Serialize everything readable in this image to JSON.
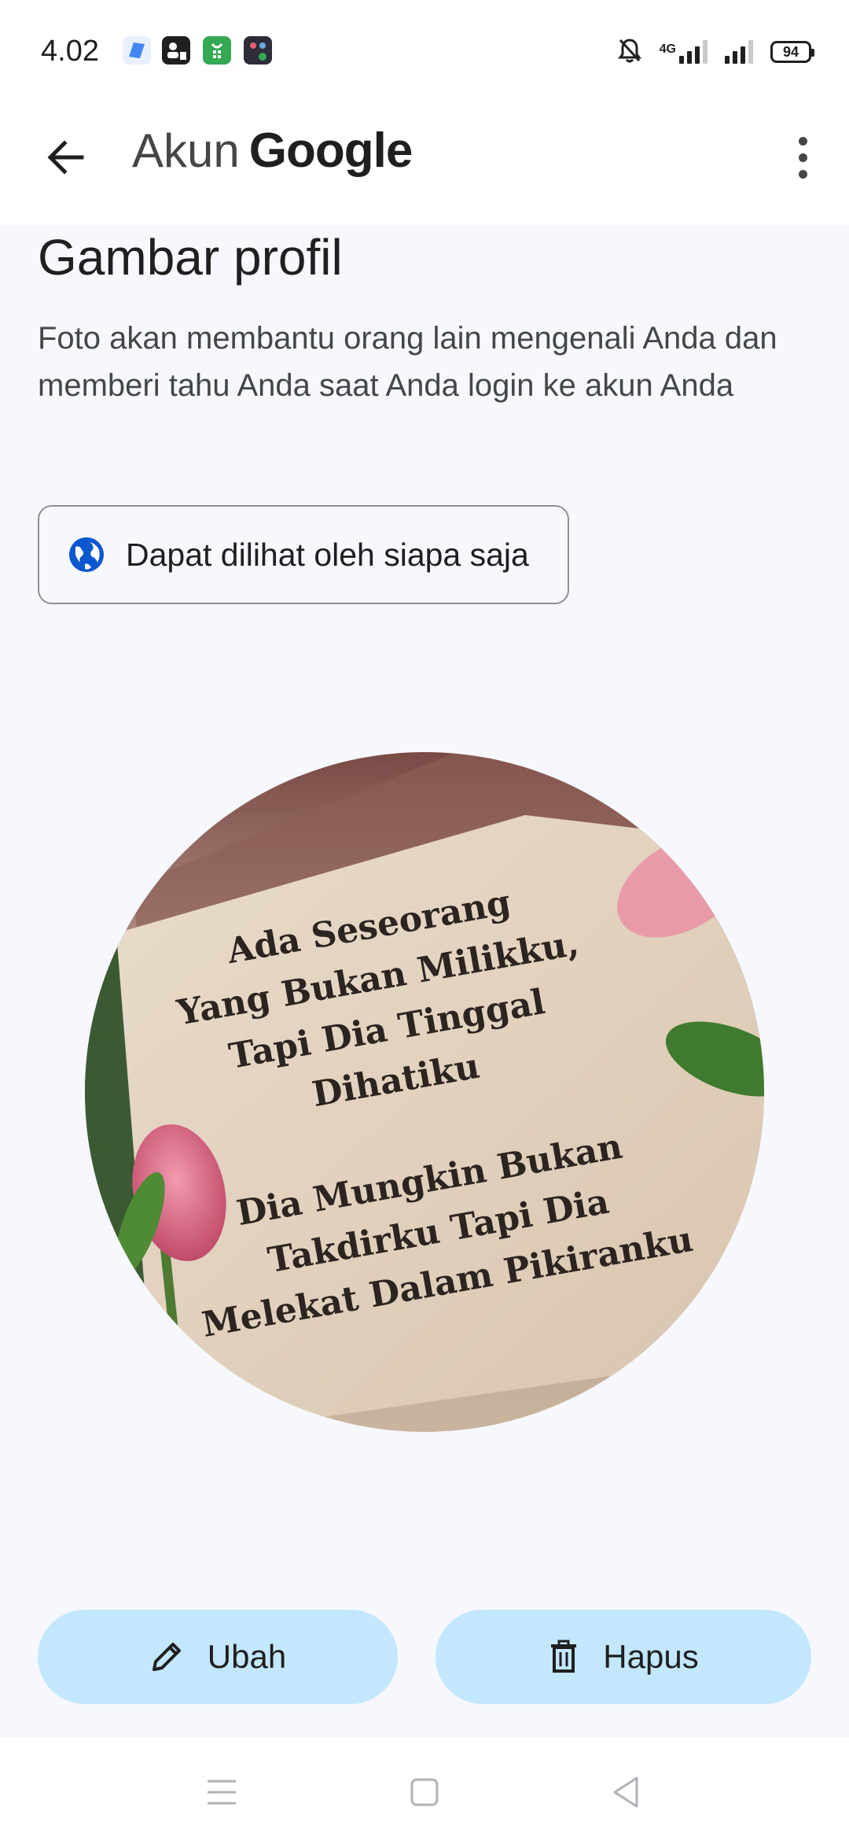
{
  "status_bar": {
    "time": "4.02",
    "network_label": "4G",
    "battery": "94",
    "notification_icons": [
      "app-notification-icon",
      "contact-card-icon",
      "store-icon",
      "chat-app-icon"
    ]
  },
  "app_bar": {
    "title_prefix": "Akun",
    "title_brand": "Google"
  },
  "page": {
    "title": "Gambar profil",
    "description": "Foto akan membantu orang lain mengenali Anda dan memberi tahu Anda saat Anda login ke akun Anda",
    "visibility_label": "Dapat dilihat oleh siapa saja"
  },
  "profile_image": {
    "text_lines_1": [
      "Ada Seseorang",
      "Yang Bukan Milikku,",
      "Tapi Dia Tinggal",
      "Dihatiku"
    ],
    "text_lines_2": [
      "Dia Mungkin Bukan",
      "Takdirku Tapi Dia",
      "Melekat Dalam Pikiranku"
    ]
  },
  "actions": {
    "edit_label": "Ubah",
    "delete_label": "Hapus"
  },
  "colors": {
    "accent_button": "#c2e7ff",
    "globe_icon": "#0b57d0",
    "background": "#f6f8fd"
  }
}
